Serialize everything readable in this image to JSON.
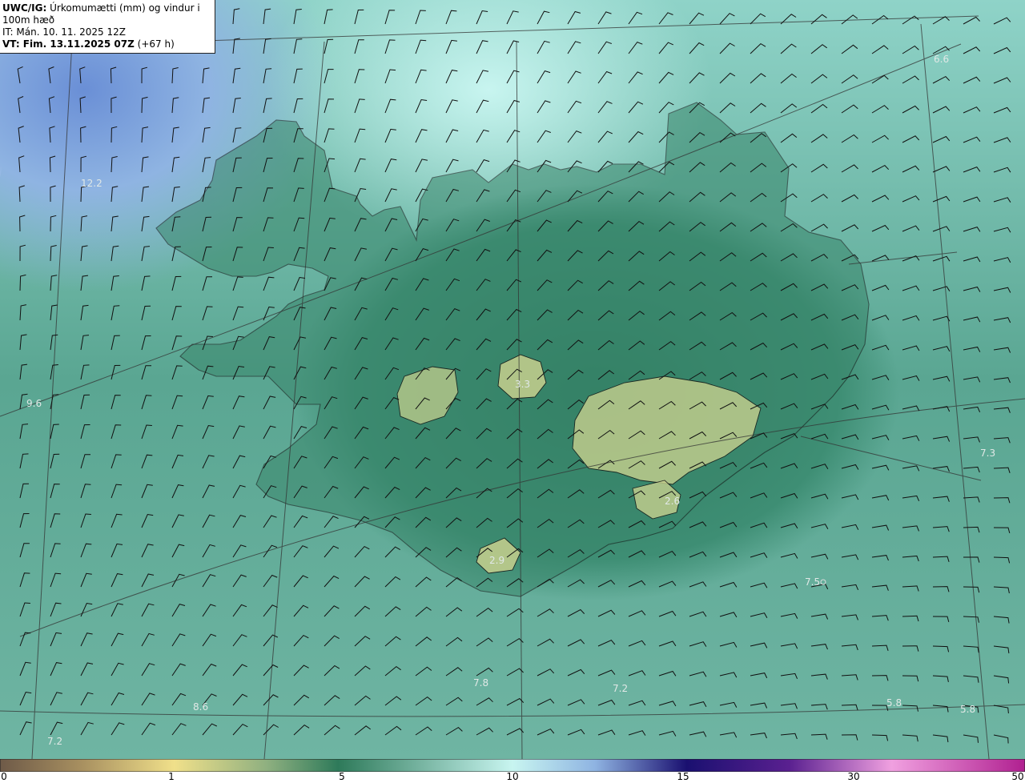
{
  "header": {
    "line1_bold": "UWC/IG:",
    "line1_rest": " Úrkomumætti (mm) og vindur i 100m hæð",
    "line2": "IT: Mán. 10. 11. 2025 12Z",
    "line3_bold": "VT: Fim. 13.11.2025 07Z",
    "line3_rest": " (+67 h)"
  },
  "map_values": [
    {
      "id": "v1",
      "text": "12.2"
    },
    {
      "id": "v2",
      "text": "6.6"
    },
    {
      "id": "v3",
      "text": "3.3"
    },
    {
      "id": "v4",
      "text": "7.3"
    },
    {
      "id": "v5",
      "text": "2.6"
    },
    {
      "id": "v6",
      "text": "2.9"
    },
    {
      "id": "v7",
      "text": "7.5"
    },
    {
      "id": "v8",
      "text": "7.8"
    },
    {
      "id": "v9",
      "text": "7.2"
    },
    {
      "id": "v10",
      "text": "5.8"
    },
    {
      "id": "v11",
      "text": "5.8"
    },
    {
      "id": "v12",
      "text": "8.6"
    },
    {
      "id": "v13",
      "text": "7.2"
    },
    {
      "id": "v14",
      "text": "9.6"
    }
  ],
  "colorbar": {
    "labels": [
      "0",
      "1",
      "5",
      "10",
      "15",
      "30",
      "50"
    ],
    "colors": {
      "brown": "#7a5a40",
      "yellow": "#f0e08a",
      "green": "#2e7a5a",
      "cyan": "#c8f5f0",
      "blue": "#3a4fc0",
      "navy": "#1a1070",
      "magenta": "#c030b0",
      "pink": "#f0a0e0"
    }
  },
  "colors": {
    "ocean_teal": "#5fa895",
    "land_green": "#3f8a6e",
    "highland_yellow": "#b8c98a",
    "sea_blue": "#7e9fd8",
    "sea_cyan": "#b6ece4",
    "coastline": "#111111"
  }
}
